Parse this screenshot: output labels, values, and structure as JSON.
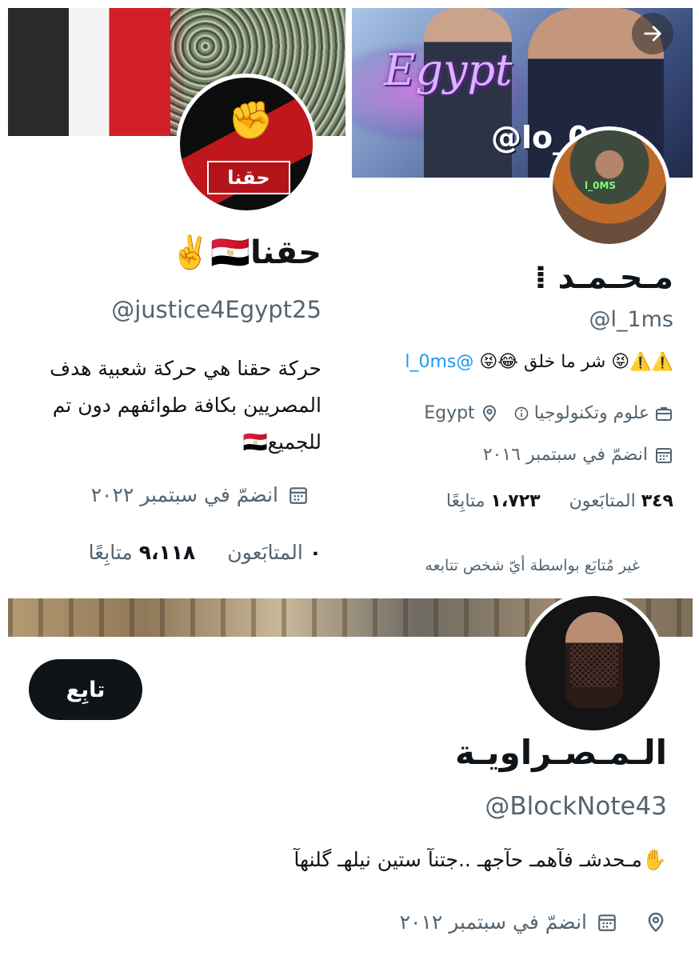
{
  "profile_left": {
    "name": "حقنا🇪🇬✌️",
    "handle": "@justice4Egypt25",
    "bio_lines": [
      "حركة حقنا هي حركة شعبية هدف",
      "المصريين بكافة طوائفهم دون تم",
      "للجميع🇪🇬"
    ],
    "joined": "انضمّ في سبتمبر ٢٠٢٢",
    "following_count": "٩،١١٨",
    "following_label": "متابِعًا",
    "followers_count": "٠",
    "followers_label": "المتابَعون",
    "avatar_text": "حقنا"
  },
  "profile_right": {
    "name": "مـحـمـد ⁞",
    "handle": "@l_1ms",
    "bio_text": "⚠️⚠️😝 شر ما خلق 😂😝",
    "bio_mention": "@l_0ms",
    "category": "علوم وتكنولوجيا",
    "location": "Egypt",
    "joined": "انضمّ في سبتمبر ٢٠١٦",
    "followers_count": "٣٤٩",
    "followers_label": "المتابَعون",
    "following_count": "١،٧٢٣",
    "following_label": "متابِعًا",
    "not_followed_note": "غير مُتابَع بواسطة أيّ شخص تتابعه",
    "banner_text": "Egypt",
    "banner_watermark": "@lo_0ms",
    "avatar_tag": "l_0MS"
  },
  "profile_bottom": {
    "follow_button": "تابِع",
    "name": "الـمـصـراويـة",
    "handle": "@BlockNote43",
    "bio": "✋مـحدشـ فآهمـ حآجهـ ..جتنآ ستين نيلهـ گلنهآ",
    "joined": "انضمّ في سبتمبر ٢٠١٢"
  },
  "icons": {
    "arrow": "arrow-right-icon",
    "calendar": "calendar-icon",
    "location": "location-pin-icon",
    "briefcase": "briefcase-icon",
    "info": "info-icon"
  },
  "colors": {
    "text": "#0f1419",
    "muted": "#536471",
    "link": "#1d9bf0",
    "button": "#0f1419"
  }
}
